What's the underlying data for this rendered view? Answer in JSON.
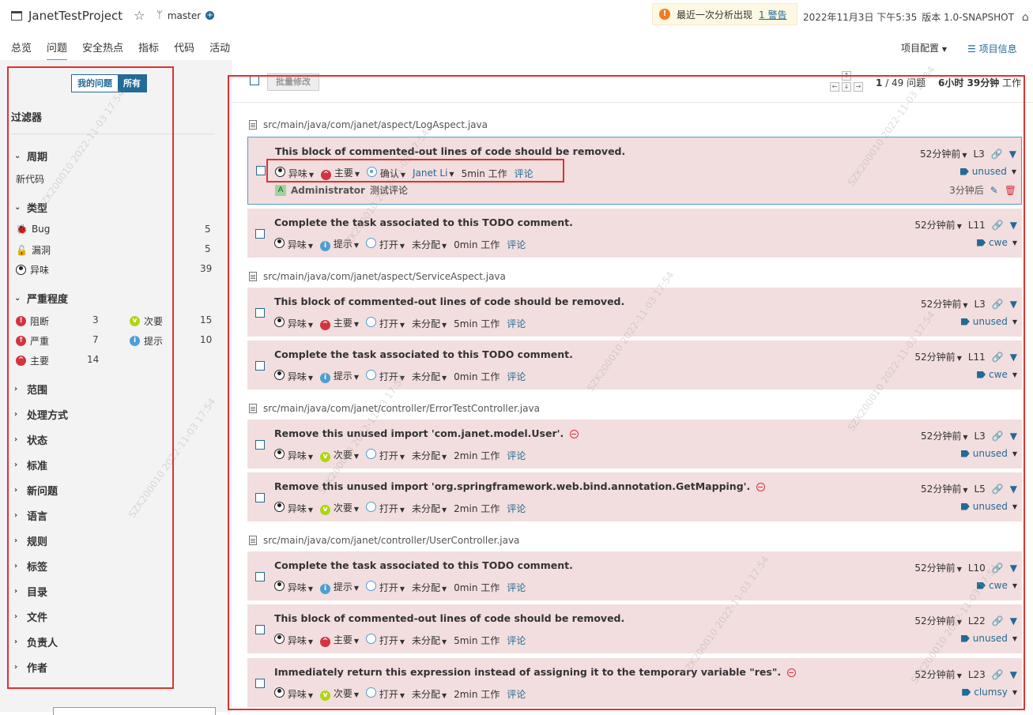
{
  "header": {
    "project_name": "JanetTestProject",
    "branch": "master",
    "warning_text": "最近一次分析出现",
    "warning_link": "1 警告",
    "date": "2022年11月3日 下午5:35",
    "version": "版本 1.0-SNAPSHOT"
  },
  "nav": {
    "tabs": [
      "总览",
      "问题",
      "安全热点",
      "指标",
      "代码",
      "活动"
    ],
    "active_tab": "问题",
    "project_config": "项目配置",
    "project_info": "项目信息"
  },
  "sidebar": {
    "my_issues": "我的问题",
    "all": "所有",
    "filters_title": "过滤器",
    "period": {
      "title": "周期",
      "item": "新代码"
    },
    "type": {
      "title": "类型",
      "items": [
        {
          "label": "Bug",
          "count": "5"
        },
        {
          "label": "漏洞",
          "count": "5"
        },
        {
          "label": "异味",
          "count": "39"
        }
      ]
    },
    "severity": {
      "title": "严重程度",
      "items": [
        {
          "label": "阻断",
          "count": "3"
        },
        {
          "label": "严重",
          "count": "7"
        },
        {
          "label": "主要",
          "count": "14"
        },
        {
          "label": "次要",
          "count": "15"
        },
        {
          "label": "提示",
          "count": "10"
        }
      ]
    },
    "collapsed": [
      "范围",
      "处理方式",
      "状态",
      "标准",
      "新问题",
      "语言",
      "规则",
      "标签",
      "目录",
      "文件",
      "负责人",
      "作者"
    ]
  },
  "toolbar": {
    "bulk_change": "批量修改",
    "paging_current": "1",
    "paging_total": "/ 49 问题",
    "effort": "6小时 39分钟",
    "effort_suffix": "工作"
  },
  "files": [
    "src/main/java/com/janet/aspect/LogAspect.java",
    "src/main/java/com/janet/aspect/ServiceAspect.java",
    "src/main/java/com/janet/controller/ErrorTestController.java",
    "src/main/java/com/janet/controller/UserController.java"
  ],
  "issues": [
    {
      "message": "This block of commented-out lines of code should be removed.",
      "type": "异味",
      "severity": "主要",
      "status": "确认",
      "assignee": "Janet Li",
      "effort": "5min 工作",
      "comment": "评论",
      "age": "52分钟前",
      "line": "L3",
      "tag": "unused"
    },
    {
      "message": "Complete the task associated to this TODO comment.",
      "type": "异味",
      "severity": "提示",
      "status": "打开",
      "assignee": "未分配",
      "effort": "0min 工作",
      "comment": "评论",
      "age": "52分钟前",
      "line": "L11",
      "tag": "cwe"
    },
    {
      "message": "This block of commented-out lines of code should be removed.",
      "type": "异味",
      "severity": "主要",
      "status": "打开",
      "assignee": "未分配",
      "effort": "5min 工作",
      "comment": "评论",
      "age": "52分钟前",
      "line": "L3",
      "tag": "unused"
    },
    {
      "message": "Complete the task associated to this TODO comment.",
      "type": "异味",
      "severity": "提示",
      "status": "打开",
      "assignee": "未分配",
      "effort": "0min 工作",
      "comment": "评论",
      "age": "52分钟前",
      "line": "L11",
      "tag": "cwe"
    },
    {
      "message": "Remove this unused import 'com.janet.model.User'.",
      "type": "异味",
      "severity": "次要",
      "status": "打开",
      "assignee": "未分配",
      "effort": "2min 工作",
      "comment": "评论",
      "age": "52分钟前",
      "line": "L3",
      "tag": "unused"
    },
    {
      "message": "Remove this unused import 'org.springframework.web.bind.annotation.GetMapping'.",
      "type": "异味",
      "severity": "次要",
      "status": "打开",
      "assignee": "未分配",
      "effort": "2min 工作",
      "comment": "评论",
      "age": "52分钟前",
      "line": "L5",
      "tag": "unused"
    },
    {
      "message": "Complete the task associated to this TODO comment.",
      "type": "异味",
      "severity": "提示",
      "status": "打开",
      "assignee": "未分配",
      "effort": "0min 工作",
      "comment": "评论",
      "age": "52分钟前",
      "line": "L10",
      "tag": "cwe"
    },
    {
      "message": "This block of commented-out lines of code should be removed.",
      "type": "异味",
      "severity": "主要",
      "status": "打开",
      "assignee": "未分配",
      "effort": "5min 工作",
      "comment": "评论",
      "age": "52分钟前",
      "line": "L22",
      "tag": "unused"
    },
    {
      "message": "Immediately return this expression instead of assigning it to the temporary variable \"res\".",
      "type": "异味",
      "severity": "次要",
      "status": "打开",
      "assignee": "未分配",
      "effort": "2min 工作",
      "comment": "评论",
      "age": "52分钟前",
      "line": "L23",
      "tag": "clumsy"
    }
  ],
  "first_comment": {
    "author": "Administrator",
    "avatar_letter": "A",
    "text": "测试评论",
    "time": "3分钟后"
  },
  "watermark": "SZK200010 2022-11-03 17:54",
  "colors": {
    "accent": "#236a97",
    "issue_bg": "#f2dede",
    "annotation_red": "#e03030",
    "major": "#d4333f",
    "minor": "#b0d513",
    "info": "#4b9fd5"
  }
}
